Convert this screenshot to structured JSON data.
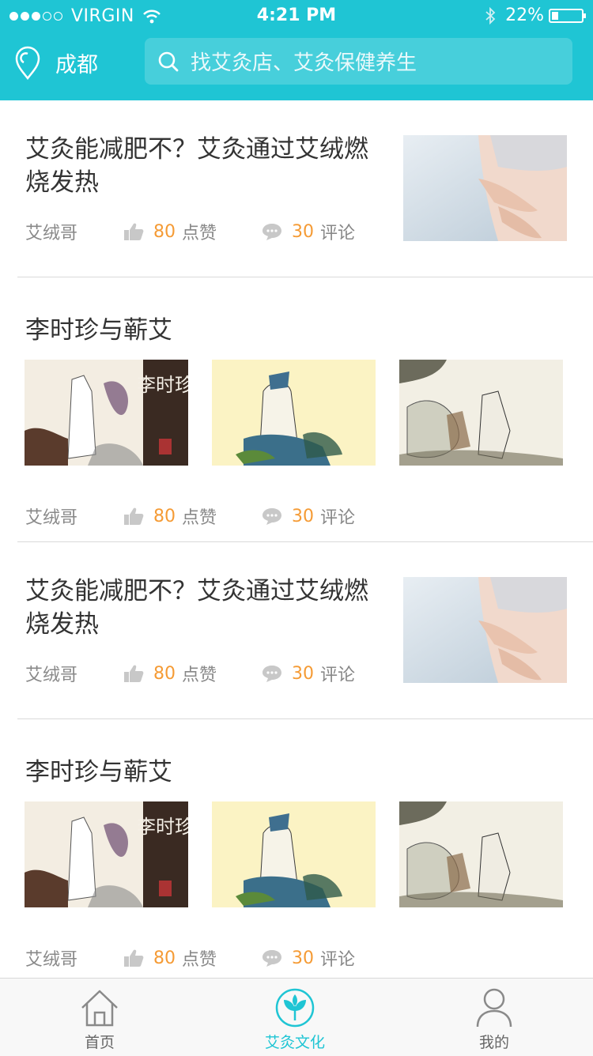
{
  "status_bar": {
    "carrier": "VIRGIN",
    "time": "4:21 PM",
    "battery": "22%",
    "battery_level": 0.22
  },
  "header": {
    "city": "成都",
    "search_placeholder": "找艾灸店、艾灸保健养生",
    "accent_color": "#1fc5d4"
  },
  "articles": [
    {
      "title": "艾灸能减肥不？艾灸通过艾绒燃烧发热",
      "author": "艾绒哥",
      "likes": "80",
      "likes_label": "点赞",
      "comments": "30",
      "comments_label": "评论"
    },
    {
      "title": "李时珍与蕲艾",
      "author": "艾绒哥",
      "likes": "80",
      "likes_label": "点赞",
      "comments": "30",
      "comments_label": "评论",
      "image_text": "李时珍"
    },
    {
      "title": "艾灸能减肥不？艾灸通过艾绒燃烧发热",
      "author": "艾绒哥",
      "likes": "80",
      "likes_label": "点赞",
      "comments": "30",
      "comments_label": "评论"
    },
    {
      "title": "李时珍与蕲艾",
      "author": "艾绒哥",
      "likes": "80",
      "likes_label": "点赞",
      "comments": "30",
      "comments_label": "评论",
      "image_text": "李时珍"
    }
  ],
  "tabs": [
    {
      "label": "首页",
      "icon": "home-icon",
      "active": false
    },
    {
      "label": "艾灸文化",
      "icon": "leaf-icon",
      "active": true
    },
    {
      "label": "我的",
      "icon": "user-icon",
      "active": false
    }
  ]
}
